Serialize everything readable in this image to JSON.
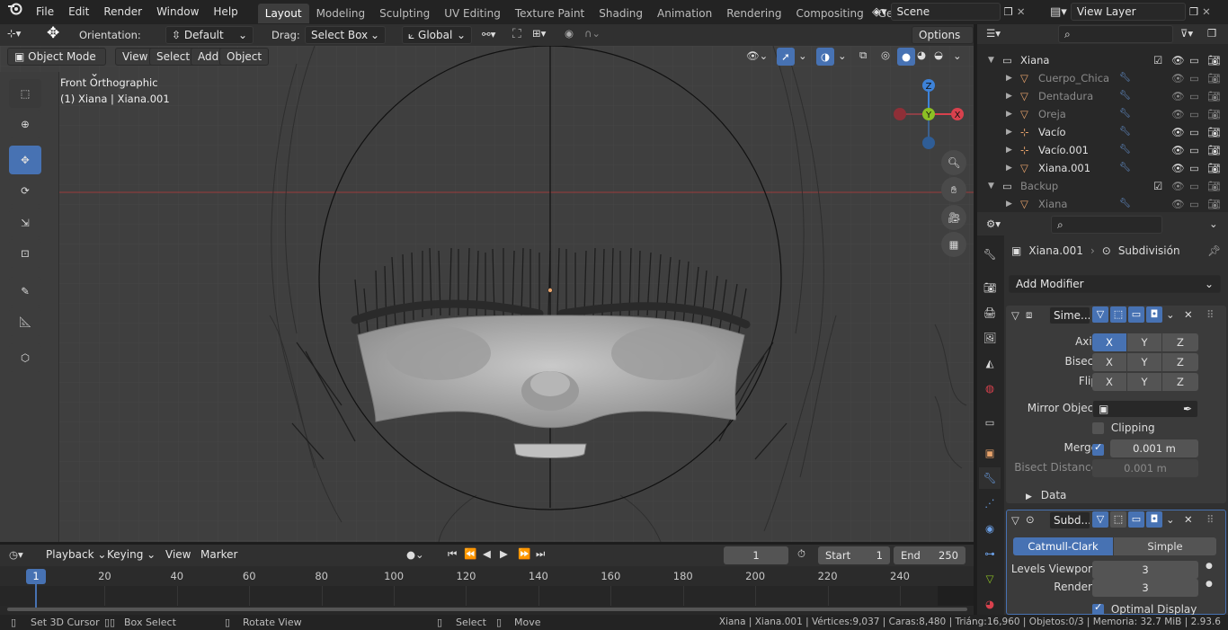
{
  "menus": [
    "File",
    "Edit",
    "Render",
    "Window",
    "Help"
  ],
  "workspaces": [
    "Layout",
    "Modeling",
    "Sculpting",
    "UV Editing",
    "Texture Paint",
    "Shading",
    "Animation",
    "Rendering",
    "Compositing",
    "Geometry Nod"
  ],
  "scene": "Scene",
  "view_layer": "View Layer",
  "tool_header": {
    "orientation_label": "Orientation:",
    "orientation_value": "Default",
    "drag_label": "Drag:",
    "drag_value": "Select Box",
    "transform_value": "Global",
    "options": "Options"
  },
  "viewport_header": {
    "mode": "Object Mode",
    "menus": [
      "View",
      "Select",
      "Add",
      "Object"
    ]
  },
  "viewport": {
    "view_name": "Front Orthographic",
    "object_info": "(1) Xiana | Xiana.001"
  },
  "gizmo": {
    "z": "Z",
    "y": "Y",
    "x": "X"
  },
  "outliner": {
    "search_placeholder": "",
    "rows": [
      {
        "name": "Xiana",
        "kind": "collection"
      },
      {
        "name": "Cuerpo_Chica",
        "kind": "mesh",
        "dim": true
      },
      {
        "name": "Dentadura",
        "kind": "mesh",
        "dim": true
      },
      {
        "name": "Oreja",
        "kind": "mesh",
        "dim": true
      },
      {
        "name": "Vacío",
        "kind": "empty"
      },
      {
        "name": "Vacío.001",
        "kind": "empty"
      },
      {
        "name": "Xiana.001",
        "kind": "mesh"
      },
      {
        "name": "Backup",
        "kind": "collection",
        "dim": true
      },
      {
        "name": "Xiana",
        "kind": "mesh",
        "dim": true
      }
    ]
  },
  "properties": {
    "object_name": "Xiana.001",
    "modifier_context": "Subdivisión",
    "add_modifier": "Add Modifier",
    "mirror": {
      "name": "Sime...",
      "axis_label": "Axis",
      "bisect_label": "Bisect",
      "flip_label": "Flip",
      "axes": [
        "X",
        "Y",
        "Z"
      ],
      "mirror_object_label": "Mirror Object",
      "clipping_label": "Clipping",
      "merge_label": "Merge",
      "merge_value": "0.001 m",
      "bisect_distance_label": "Bisect Distance",
      "bisect_distance_value": "0.001 m",
      "data_label": "Data"
    },
    "subdivision": {
      "name": "Subd...",
      "catmull": "Catmull-Clark",
      "simple": "Simple",
      "levels_viewport_label": "Levels Viewpor",
      "levels_viewport_value": "3",
      "render_label": "Render",
      "render_value": "3",
      "optimal_display_label": "Optimal Display"
    }
  },
  "timeline": {
    "menus": [
      "Playback",
      "Keying",
      "View",
      "Marker"
    ],
    "current_frame": "1",
    "start_label": "Start",
    "start_value": "1",
    "end_label": "End",
    "end_value": "250",
    "ticks": [
      "1",
      "20",
      "40",
      "60",
      "80",
      "100",
      "120",
      "140",
      "160",
      "180",
      "200",
      "220",
      "240"
    ]
  },
  "statusbar": {
    "set_cursor": "Set 3D Cursor",
    "box_select": "Box Select",
    "rotate_view": "Rotate View",
    "select": "Select",
    "move": "Move",
    "stats": "Xiana | Xiana.001 | Vértices:9,037 | Caras:8,480 | Triáng:16,960 | Objetos:0/3 | Memoria: 32.7 MiB | 2.93.6"
  },
  "colors": {
    "accent": "#4772b3",
    "viewport_bg": "#3f3f3f",
    "mesh_orange": "#e8a36b",
    "axis_x": "#d8414d",
    "axis_y": "#8cc024",
    "axis_z": "#3d82d8"
  }
}
